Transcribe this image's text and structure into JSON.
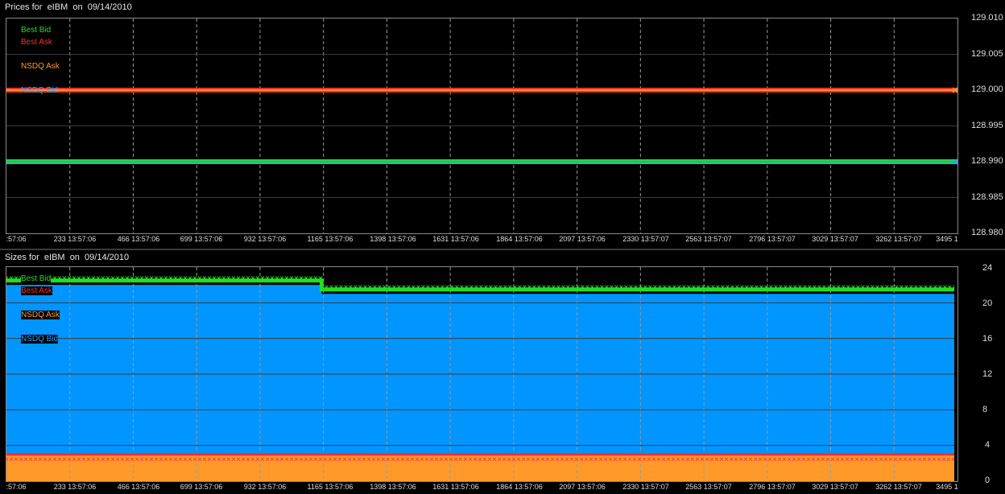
{
  "panels": [
    {
      "title": "Prices for  eIBM  on  09/14/2010",
      "y_ticks": [
        "129.010",
        "129.005",
        "129.000",
        "128.995",
        "128.990",
        "128.985",
        "128.980"
      ],
      "x_ticks": [
        ":57:06",
        "233 13:57:06",
        "466 13:57:06",
        "699 13:57:06",
        "932 13:57:06",
        "1165 13:57:06",
        "1398 13:57:06",
        "1631 13:57:06",
        "1864 13:57:06",
        "2097 13:57:06",
        "2330 13:57:07",
        "2563 13:57:07",
        "2796 13:57:07",
        "3029 13:57:07",
        "3262 13:57:07",
        "3495 1"
      ],
      "legend": [
        {
          "label": "Best Bid",
          "color": "#22dd22"
        },
        {
          "label": "Best Ask",
          "color": "#ff2a2a"
        },
        {
          "label": "NSDQ Ask",
          "color": "#ff9a2a"
        },
        {
          "label": "NSDQ Bid",
          "color": "#2aa0ff"
        }
      ]
    },
    {
      "title": "Sizes for  eIBM  on  09/14/2010",
      "y_ticks": [
        "24",
        "20",
        "16",
        "12",
        "8",
        "4",
        "0"
      ],
      "x_ticks": [
        ":57:06",
        "233 13:57:06",
        "466 13:57:06",
        "699 13:57:06",
        "932 13:57:06",
        "1165 13:57:06",
        "1398 13:57:06",
        "1631 13:57:06",
        "1864 13:57:06",
        "2097 13:57:06",
        "2330 13:57:07",
        "2563 13:57:07",
        "2796 13:57:07",
        "3029 13:57:07",
        "3262 13:57:07",
        "3495 1"
      ],
      "legend": [
        {
          "label": "Best Bid",
          "color": "#22dd22"
        },
        {
          "label": "Best Ask",
          "color": "#ff2a2a"
        },
        {
          "label": "NSDQ Ask",
          "color": "#ff9a2a"
        },
        {
          "label": "NSDQ Bid",
          "color": "#2aa0ff"
        }
      ]
    }
  ],
  "chart_data": [
    {
      "type": "line",
      "title": "Prices for  eIBM  on  09/14/2010",
      "ylim": [
        128.98,
        129.01
      ],
      "xlim": [
        0,
        3500
      ],
      "grid": true,
      "legend_position": "top-left",
      "series": [
        {
          "name": "Best Bid",
          "color": "#22dd22",
          "x": [
            0,
            3500
          ],
          "y": [
            128.99,
            128.99
          ]
        },
        {
          "name": "Best Ask",
          "color": "#ff2a2a",
          "x": [
            0,
            3500
          ],
          "y": [
            129.0,
            129.0
          ]
        },
        {
          "name": "NSDQ Ask",
          "color": "#ff9a2a",
          "x": [
            0,
            3500
          ],
          "y": [
            129.0,
            129.0
          ]
        },
        {
          "name": "NSDQ Bid",
          "color": "#2aa0ff",
          "x": [
            0,
            3500
          ],
          "y": [
            128.99,
            128.99
          ]
        }
      ]
    },
    {
      "type": "area",
      "title": "Sizes for  eIBM  on  09/14/2010",
      "ylim": [
        0,
        24
      ],
      "xlim": [
        0,
        3500
      ],
      "grid": true,
      "legend_position": "top-left",
      "series": [
        {
          "name": "NSDQ Bid",
          "color": "#0095ff",
          "x": [
            0,
            1160,
            1160,
            3500
          ],
          "y": [
            22,
            22,
            21,
            21
          ]
        },
        {
          "name": "Best Bid",
          "color": "#22dd22",
          "x": [
            0,
            1160,
            1160,
            3500
          ],
          "y": [
            22.5,
            22.5,
            21.5,
            21.5
          ]
        },
        {
          "name": "NSDQ Ask",
          "color": "#ff9a2a",
          "x": [
            0,
            3500
          ],
          "y": [
            3,
            3
          ]
        },
        {
          "name": "Best Ask",
          "color": "#ff2a2a",
          "x": [
            0,
            3500
          ],
          "y": [
            3,
            3
          ]
        }
      ]
    }
  ]
}
